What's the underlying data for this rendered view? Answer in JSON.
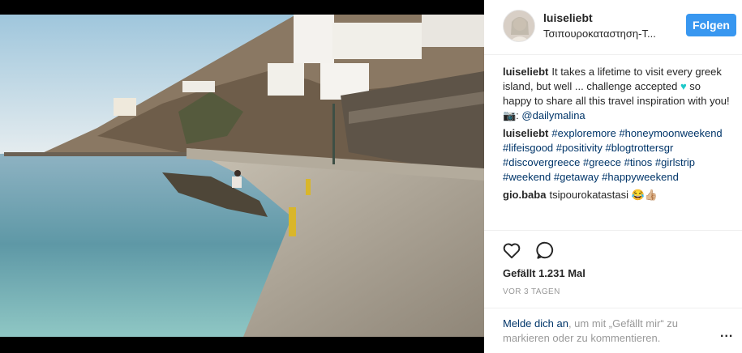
{
  "post": {
    "username": "luiseliebt",
    "location": "Τσιπουροκαταστηση-Τ...",
    "follow_label": "Folgen"
  },
  "comments": [
    {
      "user": "luiseliebt",
      "segments": [
        {
          "t": "It takes a lifetime to visit every greek island, but well ... challenge accepted ",
          "hl": false
        },
        {
          "t": "♥",
          "hl": false,
          "icon": "teal-heart"
        },
        {
          "t": " so happy to share all this travel inspiration with you! 📷: ",
          "hl": false
        },
        {
          "t": "@dailymalina",
          "hl": true
        }
      ]
    },
    {
      "user": "luiseliebt",
      "segments": [
        {
          "t": "#exploremore #honeymoonweekend #lifeisgood #positivity #blogtrottersgr #discovergreece #greece #tinos #girlstrip #weekend #getaway #happyweekend",
          "hl": true
        }
      ]
    },
    {
      "user": "gio.baba",
      "segments": [
        {
          "t": "tsipourokatastasi 😂👍🏼",
          "hl": false
        }
      ]
    }
  ],
  "actions": {
    "like_icon": "heart-outline-icon",
    "comment_icon": "comment-bubble-icon",
    "likes_text": "Gefällt 1.231 Mal",
    "time_text": "VOR 3 TAGEN"
  },
  "login_prompt": {
    "link_text": "Melde dich an",
    "rest_text": ", um mit „Gefällt mir“ zu markieren oder zu kommentieren.",
    "more_label": "..."
  },
  "colors": {
    "follow_button": "#3897f0",
    "link": "#003569",
    "muted": "#999999"
  }
}
